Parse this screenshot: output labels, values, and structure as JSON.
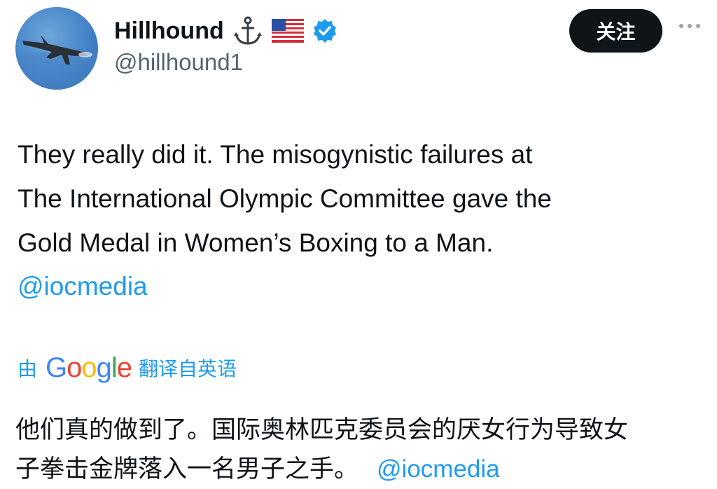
{
  "author": {
    "name": "Hillhound",
    "handle": "@hillhound1",
    "emoji_icons": [
      "anchor-icon",
      "us-flag-icon"
    ],
    "verified": true
  },
  "actions": {
    "follow_label": "关注",
    "more_icon": "more-icon"
  },
  "tweet": {
    "lines": [
      "They really did it.  The misogynistic failures at",
      "The International Olympic Committee gave the",
      "Gold Medal in Women’s Boxing to a Man."
    ],
    "mention": "@iocmedia"
  },
  "translation": {
    "by": "由",
    "google": "Google",
    "label": "翻译自英语",
    "lines": [
      "他们真的做到了。国际奥林匹克委员会的厌女行为导致女",
      "子拳击金牌落入一名男子之手。"
    ],
    "mention": "@iocmedia"
  },
  "colors": {
    "accent": "#1d9bf0",
    "text": "#0f1419",
    "secondary": "#536471",
    "google": [
      "#4285F4",
      "#EA4335",
      "#FBBC05",
      "#34A853"
    ]
  }
}
